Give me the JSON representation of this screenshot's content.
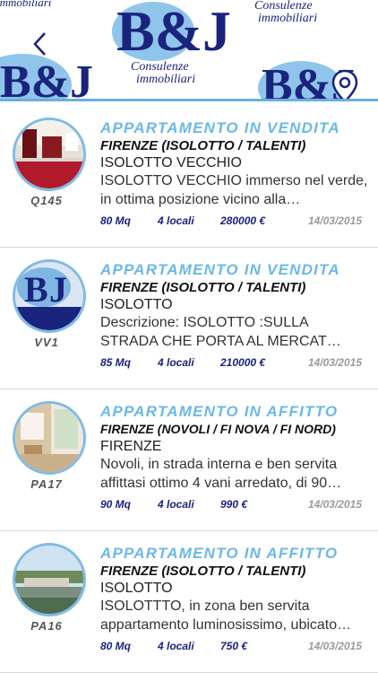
{
  "header": {
    "brand": "B&J",
    "brand_sub_1": "Consulenze",
    "brand_sub_2": "immobiliari",
    "back_icon": "chevron-left-icon",
    "map_icon": "map-pin-icon",
    "accent": "#6aaee0"
  },
  "listings": [
    {
      "type": "APPARTAMENTO  IN  VENDITA",
      "zone": "FIRENZE (ISOLOTTO / TALENTI)",
      "area": "ISOLOTTO VECCHIO",
      "description": "ISOLOTTO VECCHIO immerso nel verde, in ottima posizione vicino alla…",
      "code": "Q145",
      "sqm": "80 Mq",
      "rooms": "4 locali",
      "price": "280000 €",
      "date": "14/03/2015"
    },
    {
      "type": "APPARTAMENTO  IN  VENDITA",
      "zone": "FIRENZE (ISOLOTTO / TALENTI)",
      "area": "ISOLOTTO",
      "description": "Descrizione: ISOLOTTO :SULLA STRADA CHE PORTA AL MERCAT…",
      "code": "VV1",
      "sqm": "85 Mq",
      "rooms": "4 locali",
      "price": "210000 €",
      "date": "14/03/2015"
    },
    {
      "type": "APPARTAMENTO  IN  AFFITTO",
      "zone": "FIRENZE (NOVOLI / FI NOVA / FI NORD)",
      "area": "FIRENZE",
      "description": "Novoli, in strada interna e ben servita affittasi ottimo 4 vani  arredato, di 90…",
      "code": "PA17",
      "sqm": "90 Mq",
      "rooms": "4 locali",
      "price": "990 €",
      "date": "14/03/2015"
    },
    {
      "type": "APPARTAMENTO  IN  AFFITTO",
      "zone": "FIRENZE (ISOLOTTO / TALENTI)",
      "area": "ISOLOTTO",
      "description": "ISOLOTTTO, in zona ben servita appartamento luminosissimo, ubicato…",
      "code": "PA16",
      "sqm": "80 Mq",
      "rooms": "4 locali",
      "price": "750 €",
      "date": "14/03/2015"
    }
  ]
}
